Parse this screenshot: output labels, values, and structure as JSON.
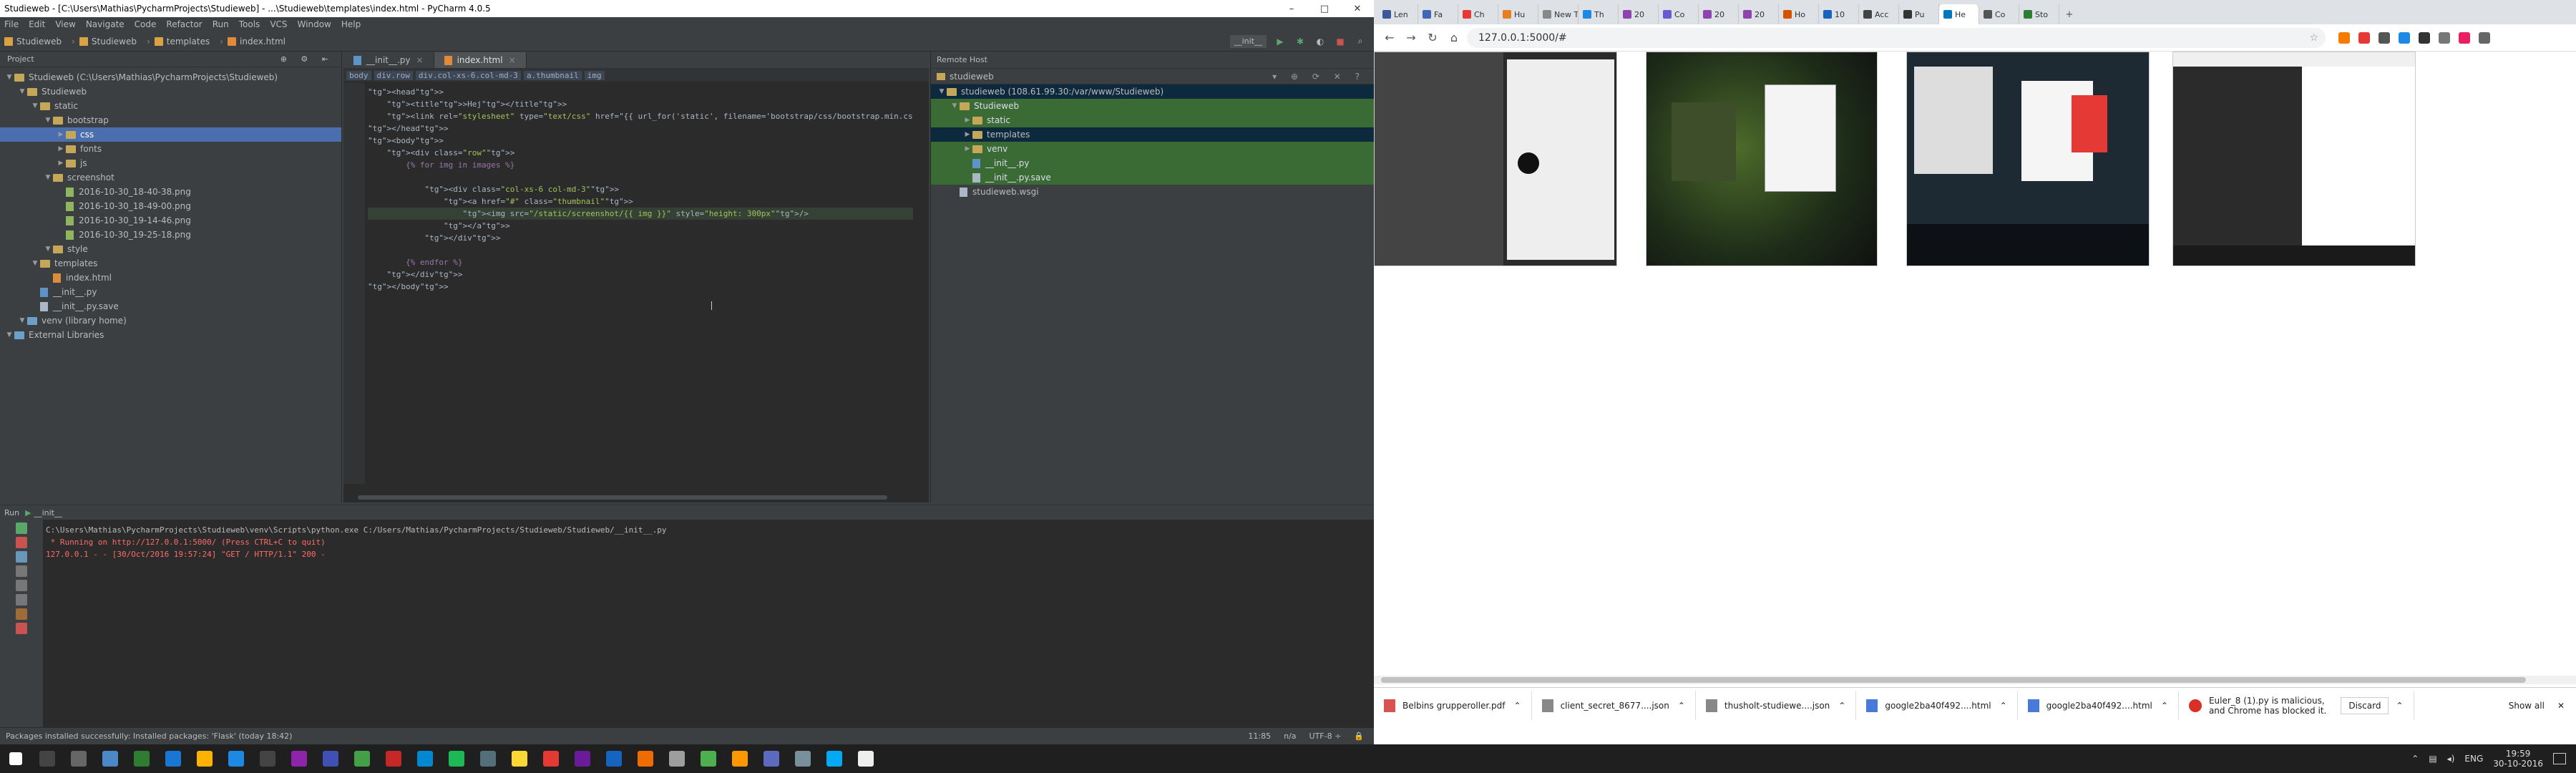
{
  "ide": {
    "title": "Studieweb - [C:\\Users\\Mathias\\PycharmProjects\\Studieweb] - ...\\Studieweb\\templates\\index.html - PyCharm 4.0.5",
    "menu": [
      "File",
      "Edit",
      "View",
      "Navigate",
      "Code",
      "Refactor",
      "Run",
      "Tools",
      "VCS",
      "Window",
      "Help"
    ],
    "breadcrumbs": [
      "Studieweb",
      "Studieweb",
      "templates",
      "index.html"
    ],
    "run_config": "__init__",
    "project_header": "Project",
    "tree": [
      {
        "label": "Studieweb (C:\\Users\\Mathias\\PycharmProjects\\Studieweb)",
        "depth": 0,
        "kind": "folder"
      },
      {
        "label": "Studieweb",
        "depth": 1,
        "kind": "folder"
      },
      {
        "label": "static",
        "depth": 2,
        "kind": "folder"
      },
      {
        "label": "bootstrap",
        "depth": 3,
        "kind": "folder"
      },
      {
        "label": "css",
        "depth": 4,
        "kind": "folder",
        "selected": true
      },
      {
        "label": "fonts",
        "depth": 4,
        "kind": "folder"
      },
      {
        "label": "js",
        "depth": 4,
        "kind": "folder"
      },
      {
        "label": "screenshot",
        "depth": 3,
        "kind": "folder"
      },
      {
        "label": "2016-10-30_18-40-38.png",
        "depth": 4,
        "kind": "img"
      },
      {
        "label": "2016-10-30_18-49-00.png",
        "depth": 4,
        "kind": "img"
      },
      {
        "label": "2016-10-30_19-14-46.png",
        "depth": 4,
        "kind": "img"
      },
      {
        "label": "2016-10-30_19-25-18.png",
        "depth": 4,
        "kind": "img"
      },
      {
        "label": "style",
        "depth": 3,
        "kind": "folder"
      },
      {
        "label": "templates",
        "depth": 2,
        "kind": "folder"
      },
      {
        "label": "index.html",
        "depth": 3,
        "kind": "html"
      },
      {
        "label": "__init__.py",
        "depth": 2,
        "kind": "py"
      },
      {
        "label": "__init__.py.save",
        "depth": 2,
        "kind": "file"
      },
      {
        "label": "venv (library home)",
        "depth": 1,
        "kind": "blue"
      },
      {
        "label": "External Libraries",
        "depth": 0,
        "kind": "blue"
      }
    ],
    "tabs": [
      "__init__.py",
      "index.html"
    ],
    "editor_crumbs": [
      "body",
      "div.row",
      "div.col-xs-6.col-md-3",
      "a.thumbnail",
      "img"
    ],
    "code": [
      "<head>",
      "    <title>Hej</title>",
      "    <link rel=\"stylesheet\" type=\"text/css\" href=\"{{ url_for('static', filename='bootstrap/css/bootstrap.min.cs",
      "</head>",
      "<body>",
      "    <div class=\"row\">",
      "        {% for img in images %}",
      "",
      "            <div class=\"col-xs-6 col-md-3\">",
      "                <a href=\"#\" class=\"thumbnail\">",
      "                    <img src=\"/static/screenshot/{{ img }}\" style=\"height: 300px\"/>",
      "                </a>",
      "            </div>",
      "",
      "        {% endfor %}",
      "    </div>",
      "</body>"
    ],
    "remote": {
      "header": "Remote Host",
      "host": "studieweb",
      "items": [
        {
          "label": "studieweb (108.61.99.30:/var/www/Studieweb)",
          "depth": 0,
          "kind": "folder",
          "green": false,
          "sel": true
        },
        {
          "label": "Studieweb",
          "depth": 1,
          "kind": "folder",
          "green": true
        },
        {
          "label": "static",
          "depth": 2,
          "kind": "folder",
          "green": true
        },
        {
          "label": "templates",
          "depth": 2,
          "kind": "folder",
          "green": false,
          "sel": true
        },
        {
          "label": "venv",
          "depth": 2,
          "kind": "folder",
          "green": true
        },
        {
          "label": "__init__.py",
          "depth": 2,
          "kind": "py",
          "green": true
        },
        {
          "label": "__init__.py.save",
          "depth": 2,
          "kind": "file",
          "green": true
        },
        {
          "label": "studieweb.wsgi",
          "depth": 1,
          "kind": "file",
          "green": false
        }
      ]
    },
    "run": {
      "title": "Run",
      "config": "__init__",
      "lines": [
        "C:\\Users\\Mathias\\PycharmProjects\\Studieweb\\venv\\Scripts\\python.exe C:/Users/Mathias/PycharmProjects/Studieweb/Studieweb/__init__.py",
        " * Running on http://127.0.0.1:5000/ (Press CTRL+C to quit)",
        "127.0.0.1 - - [30/Oct/2016 19:57:24] \"GET / HTTP/1.1\" 200 -"
      ]
    },
    "status": {
      "message": "Packages installed successfully: Installed packages: 'Flask' (today 18:42)",
      "pos": "11:85",
      "sep": "n/a",
      "enc": "UTF-8 ÷"
    }
  },
  "chrome": {
    "tabs": [
      "Len",
      "Fa",
      "Ch",
      "Hu",
      "New T",
      "Th",
      "20",
      "Co",
      "20",
      "20",
      "Ho",
      "10",
      "Acc",
      "Pu",
      "He",
      "Co",
      "Sto"
    ],
    "url": "127.0.0.1:5000/#",
    "downloads": [
      {
        "name": "Belbins grupperoller.pdf",
        "color": "#d9534f"
      },
      {
        "name": "client_secret_8677....json",
        "color": "#888"
      },
      {
        "name": "thusholt-studiewe....json",
        "color": "#888"
      },
      {
        "name": "google2ba40f492....html",
        "color": "#4a7ad9"
      },
      {
        "name": "google2ba40f492....html",
        "color": "#4a7ad9"
      }
    ],
    "warning_line1": "Euler_8 (1).py is malicious,",
    "warning_line2": "and Chrome has blocked it.",
    "discard": "Discard",
    "show_all": "Show all"
  },
  "taskbar": {
    "lang": "ENG",
    "time": "19:59",
    "date": "30-10-2016"
  }
}
